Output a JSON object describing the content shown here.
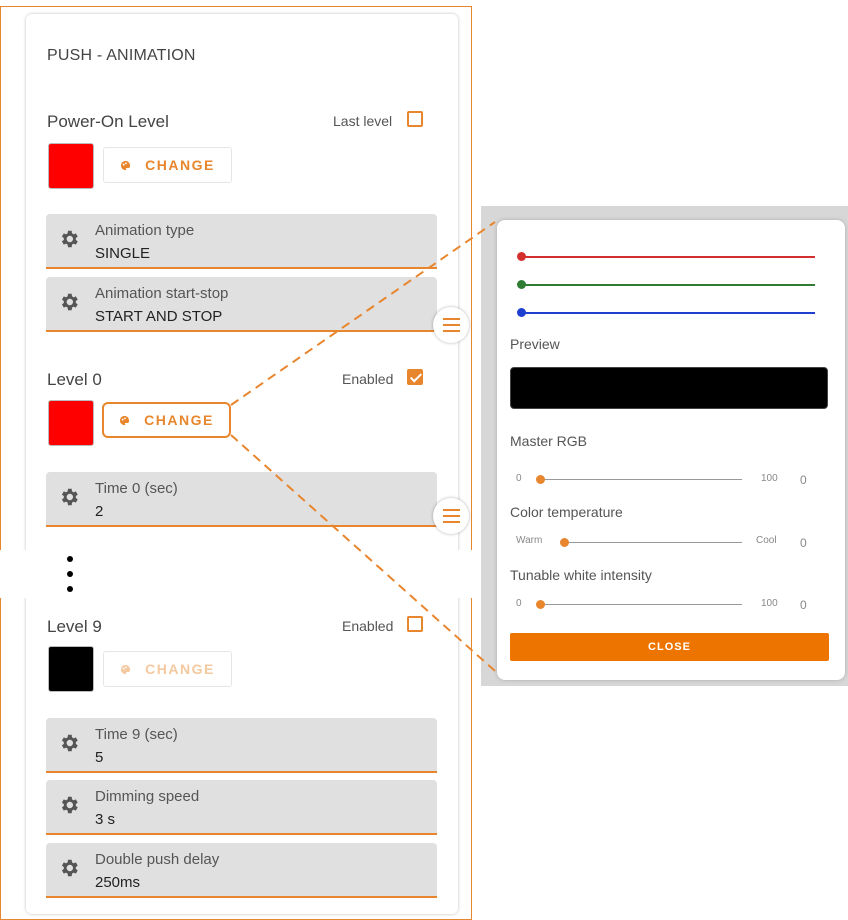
{
  "page_title": "PUSH - ANIMATION",
  "power_on": {
    "label": "Power-On Level",
    "option_label": "Last level",
    "option_checked": false,
    "color": "#ff0000",
    "change_label": "CHANGE"
  },
  "animation_fields": [
    {
      "label": "Animation type",
      "value": "SINGLE"
    },
    {
      "label": "Animation start-stop",
      "value": "START AND STOP"
    }
  ],
  "level0": {
    "label": "Level 0",
    "option_label": "Enabled",
    "option_checked": true,
    "color": "#ff0000",
    "change_label": "CHANGE",
    "time_label": "Time 0 (sec)",
    "time_value": "2"
  },
  "level9": {
    "label": "Level 9",
    "option_label": "Enabled",
    "option_checked": false,
    "color": "#000000",
    "change_label": "CHANGE",
    "time_label": "Time 9 (sec)",
    "time_value": "5"
  },
  "bottom_fields": [
    {
      "label": "Dimming speed",
      "value": "3 s"
    },
    {
      "label": "Double push delay",
      "value": "250ms"
    }
  ],
  "icons": {
    "settings": "gear-icon",
    "palette": "palette-icon",
    "menu": "menu-icon",
    "ellipsis": "vertical-ellipsis-icon"
  },
  "colors": {
    "accent": "#e8862e",
    "close_button": "#ee7400",
    "red_channel": "#d32f2f",
    "green_channel": "#2e7d32",
    "blue_channel": "#1e3fd0"
  },
  "color_dialog": {
    "preview_label": "Preview",
    "preview_color": "#000000",
    "rgb_levels": {
      "red": 0,
      "green": 0,
      "blue": 0
    },
    "master_rgb": {
      "label": "Master RGB",
      "min": "0",
      "max": "100",
      "value": "0"
    },
    "color_temperature": {
      "label": "Color temperature",
      "min": "Warm",
      "max": "Cool",
      "value": "0"
    },
    "tunable_white": {
      "label": "Tunable white intensity",
      "min": "0",
      "max": "100",
      "value": "0"
    },
    "close_label": "CLOSE"
  }
}
